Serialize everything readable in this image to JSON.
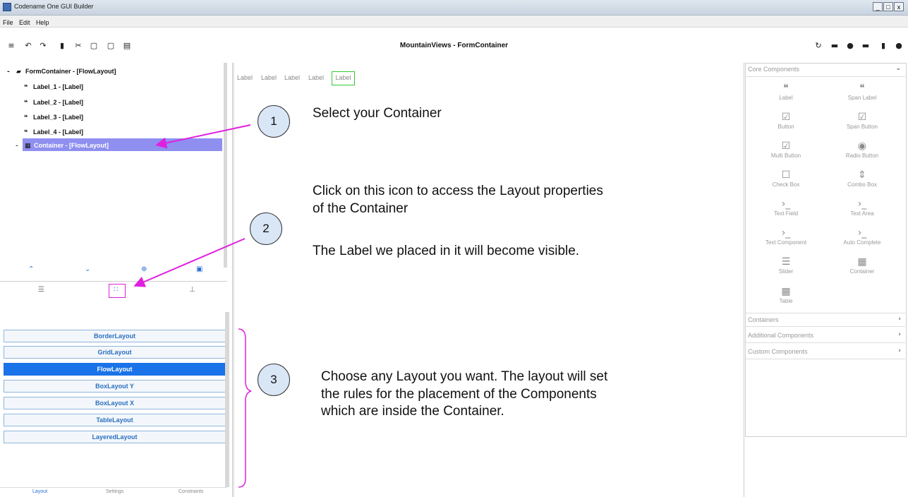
{
  "window": {
    "title": "Codename One GUI Builder",
    "controls": [
      "_",
      "□",
      "x"
    ]
  },
  "menu": [
    "File",
    "Edit",
    "Help"
  ],
  "toolbar": {
    "title": "MountainViews - FormContainer",
    "left_icons": [
      "menu-icon",
      "undo-icon",
      "redo-icon",
      "delete-icon",
      "cut-icon",
      "copy-icon",
      "paste-icon",
      "save-icon"
    ],
    "right_icons": [
      "refresh-icon",
      "preview-icon",
      "theme-icon",
      "layout-icon",
      "lock-icon",
      "settings-icon"
    ]
  },
  "tree": {
    "root": "FormContainer - [FlowLayout]",
    "items": [
      "Label_1 - [Label]",
      "Label_2 - [Label]",
      "Label_3 - [Label]",
      "Label_4 - [Label]"
    ],
    "selected": "Container - [FlowLayout]"
  },
  "layouts": [
    "BorderLayout",
    "GridLayout",
    "FlowLayout",
    "BoxLayout Y",
    "BoxLayout X",
    "TableLayout",
    "LayeredLayout"
  ],
  "selected_layout": "FlowLayout",
  "bottom_tabs": [
    "Layout",
    "Settings",
    "Constraints"
  ],
  "canvas": {
    "labels": [
      "Label",
      "Label",
      "Label",
      "Label",
      "Label"
    ]
  },
  "palette": {
    "core_title": "Core Components",
    "components": [
      {
        "name": "Label",
        "icon": "quote-icon"
      },
      {
        "name": "Span Label",
        "icon": "quote-icon"
      },
      {
        "name": "Button",
        "icon": "check-box-icon"
      },
      {
        "name": "Span Button",
        "icon": "check-box-icon"
      },
      {
        "name": "Multi Button",
        "icon": "check-box-icon"
      },
      {
        "name": "Radio Button",
        "icon": "radio-icon"
      },
      {
        "name": "Check Box",
        "icon": "checkbox-outline-icon"
      },
      {
        "name": "Combo Box",
        "icon": "combo-icon"
      },
      {
        "name": "Text Field",
        "icon": "prompt-icon"
      },
      {
        "name": "Text Area",
        "icon": "prompt-icon"
      },
      {
        "name": "Text Component",
        "icon": "prompt-icon"
      },
      {
        "name": "Auto Complete",
        "icon": "prompt-icon"
      },
      {
        "name": "Slider",
        "icon": "slider-icon"
      },
      {
        "name": "Container",
        "icon": "grid-icon"
      },
      {
        "name": "Table",
        "icon": "table-icon"
      }
    ],
    "sections": [
      "Containers",
      "Additional Components",
      "Custom Components"
    ]
  },
  "annotations": {
    "step1": {
      "num": "1",
      "text": "Select your Container"
    },
    "step2": {
      "num": "2",
      "line1": "Click on this icon to access the Layout properties",
      "line2": "of the Container",
      "line3": "The Label we placed in it will become visible."
    },
    "step3": {
      "num": "3",
      "line1": "Choose any Layout you want. The layout will set",
      "line2": "the rules for the placement of the Components",
      "line3": "which are inside the Container."
    }
  },
  "colors": {
    "accent": "#1a73e8",
    "arrow": "#e020e0",
    "selection": "#8f8ff0",
    "highlight": "#34c834"
  }
}
